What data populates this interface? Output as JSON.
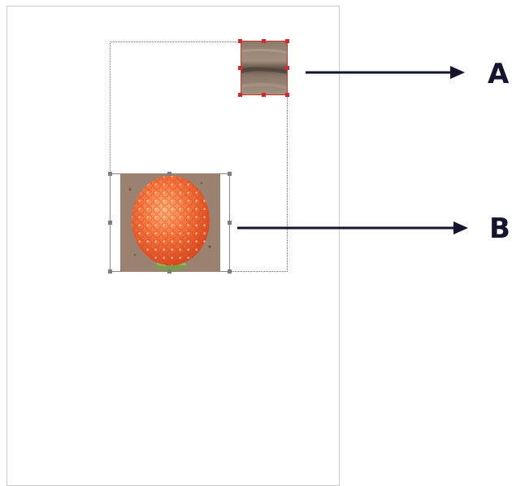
{
  "callouts": {
    "a_label": "A",
    "b_label": "B"
  },
  "colors": {
    "arrow": "#141430",
    "selection_handle_active": "#d62a2a",
    "selection_handle_inactive": "#7d7d7d"
  },
  "images": {
    "top_crop": {
      "icon": "sand-texture-image"
    },
    "raspberry": {
      "icon": "raspberry-photo"
    }
  }
}
